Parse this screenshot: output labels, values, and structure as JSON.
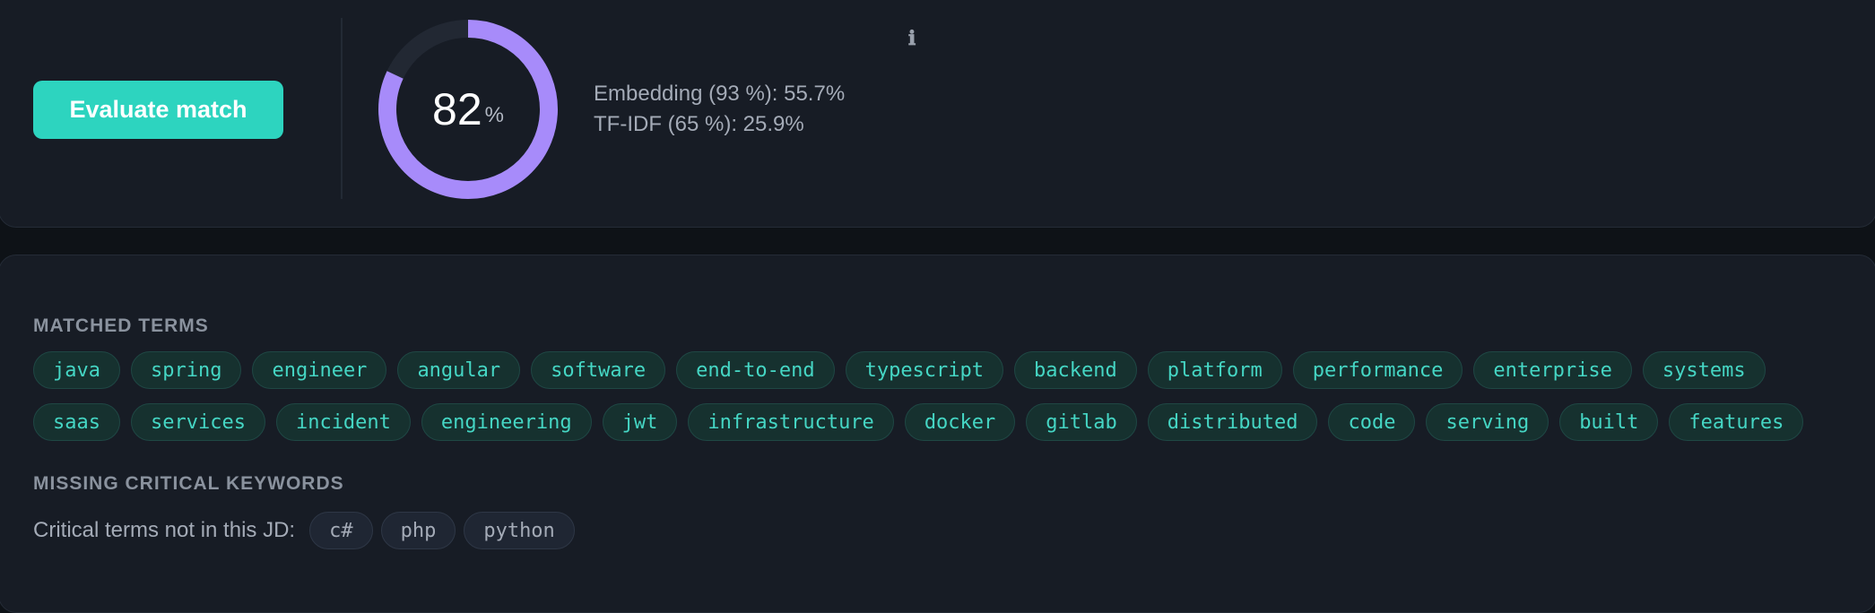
{
  "actions": {
    "evaluate_label": "Evaluate match"
  },
  "score": {
    "value": "82",
    "unit": "%",
    "fraction": 0.82,
    "ring_color": "#a78bfa",
    "track_color": "#222833"
  },
  "metrics": {
    "embedding": "Embedding (93 %): 55.7%",
    "tfidf": "TF-IDF (65 %): 25.9%"
  },
  "info": {
    "icon": "info-icon",
    "glyph": "ℹ"
  },
  "matched": {
    "heading": "MATCHED TERMS",
    "row1": [
      "java",
      "spring",
      "engineer",
      "angular",
      "software",
      "end-to-end",
      "typescript",
      "backend",
      "platform",
      "performance",
      "enterprise",
      "systems"
    ],
    "row2": [
      "saas",
      "services",
      "incident",
      "engineering",
      "jwt",
      "infrastructure",
      "docker",
      "gitlab",
      "distributed",
      "code",
      "serving",
      "built",
      "features"
    ]
  },
  "missing": {
    "heading": "MISSING CRITICAL KEYWORDS",
    "label": "Critical terms not in this JD:",
    "terms": [
      "c#",
      "php",
      "python"
    ]
  },
  "colors": {
    "accent": "#2dd4bf",
    "chip_text": "#45d6c4"
  }
}
